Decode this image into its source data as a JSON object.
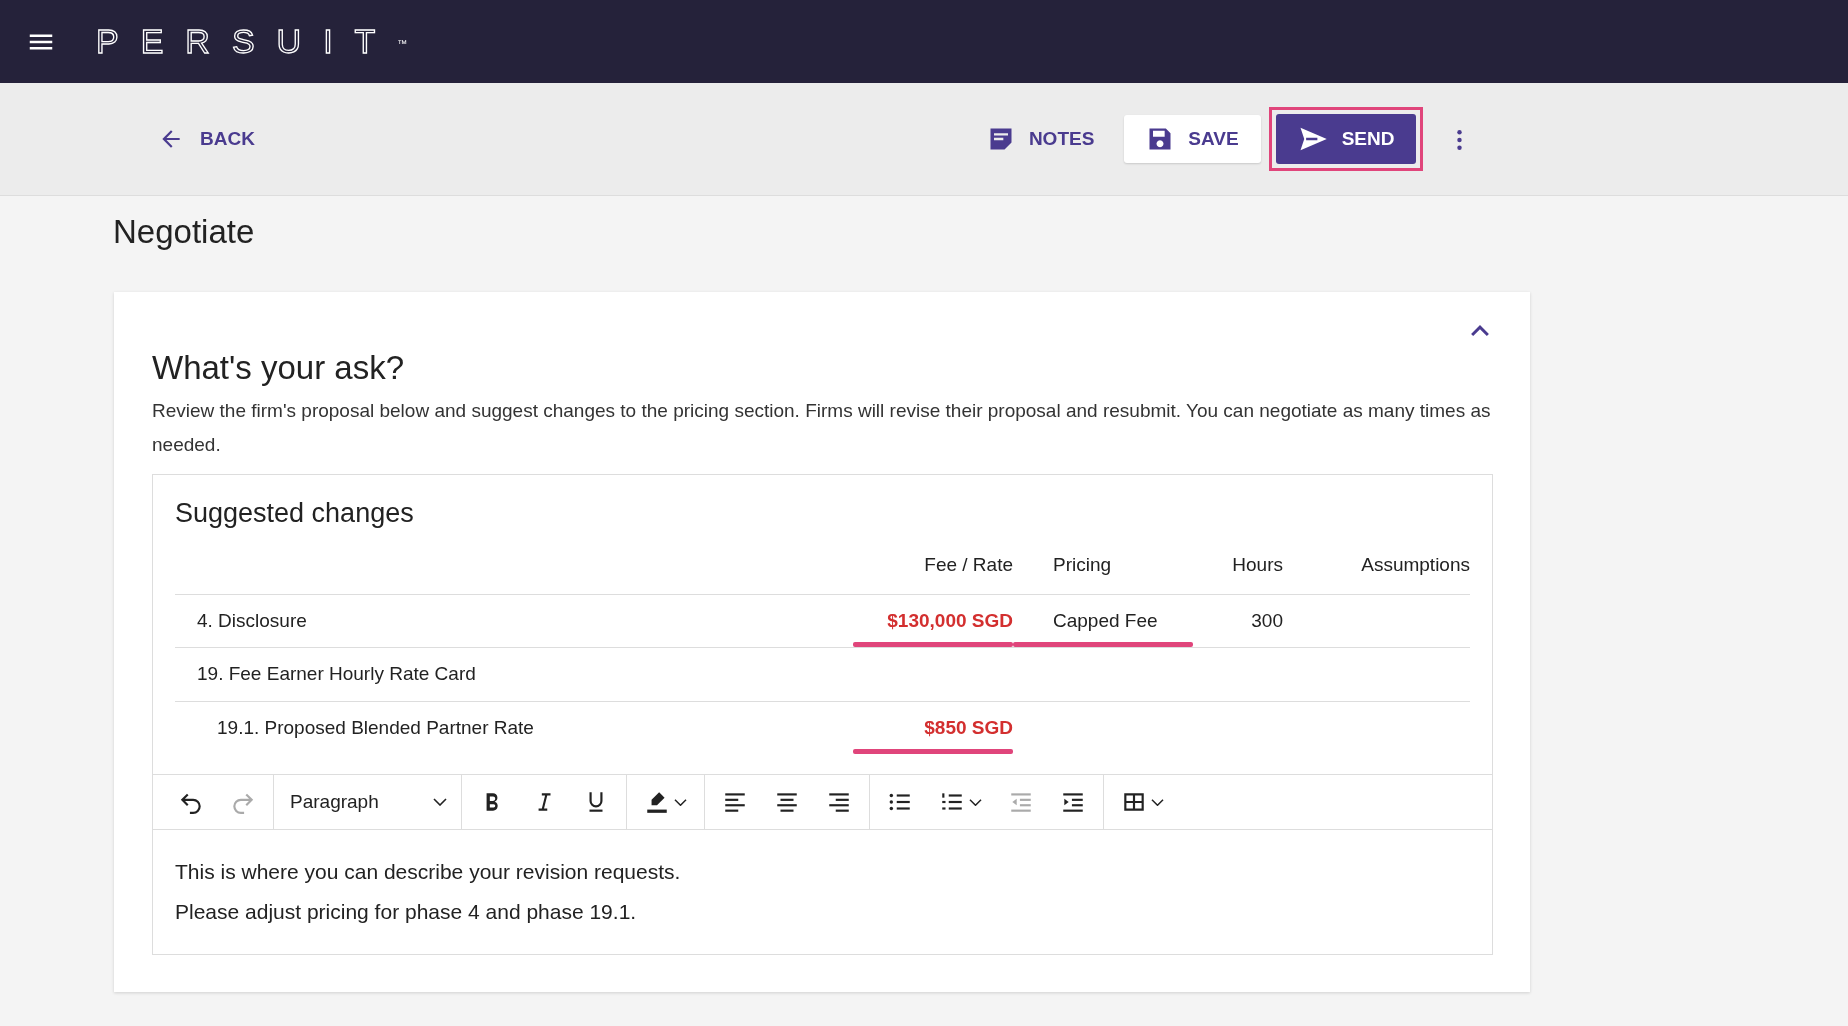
{
  "header": {
    "logo": "PERSUIT",
    "trademark": "™"
  },
  "action_bar": {
    "back": "BACK",
    "buttons": [
      {
        "kind": "notes",
        "label": "NOTES"
      },
      {
        "kind": "save",
        "label": "SAVE"
      },
      {
        "kind": "send",
        "label": "SEND",
        "highlighted": true
      }
    ]
  },
  "page_title": "Negotiate",
  "card": {
    "expanded": true,
    "heading": "What's your ask?",
    "description": "Review the firm's proposal below and suggest changes to the pricing section. Firms will revise their proposal and resubmit. You can negotiate as many times as needed.",
    "suggested_changes": {
      "title": "Suggested changes",
      "columns": [
        "Fee / Rate",
        "Pricing",
        "Hours",
        "Assumptions"
      ],
      "rows": [
        {
          "item": "4. Disclosure",
          "fee_rate": {
            "text": "$130,000 SGD",
            "changed": true
          },
          "pricing": {
            "text": "Capped Fee",
            "changed": true
          },
          "hours": {
            "text": "300"
          }
        },
        {
          "item": "19. Fee Earner Hourly Rate Card",
          "children": [
            {
              "item": "19.1. Proposed Blended Partner Rate",
              "fee_rate": {
                "text": "$850 SGD",
                "changed": true
              }
            }
          ]
        }
      ]
    },
    "editor": {
      "toolbar": [
        [
          {
            "kind": "undo",
            "disabled": false
          },
          {
            "kind": "redo",
            "disabled": true
          }
        ],
        [
          {
            "kind": "block-format",
            "label": "Paragraph",
            "disabled": false
          }
        ],
        [
          {
            "kind": "bold",
            "disabled": false
          },
          {
            "kind": "italic",
            "disabled": false
          },
          {
            "kind": "underline",
            "disabled": false
          }
        ],
        [
          {
            "kind": "highlight",
            "disabled": false
          }
        ],
        [
          {
            "kind": "align-left",
            "disabled": false
          },
          {
            "kind": "align-center",
            "disabled": false
          },
          {
            "kind": "align-right",
            "disabled": false
          }
        ],
        [
          {
            "kind": "bullet-list",
            "disabled": false
          },
          {
            "kind": "numbered-list",
            "disabled": false
          },
          {
            "kind": "outdent",
            "disabled": true
          },
          {
            "kind": "indent",
            "disabled": false
          }
        ],
        [
          {
            "kind": "table",
            "disabled": false
          }
        ]
      ],
      "paragraphs": [
        "This is where you can describe your revision requests.",
        "Please adjust pricing for phase 4 and phase 19.1."
      ]
    }
  }
}
